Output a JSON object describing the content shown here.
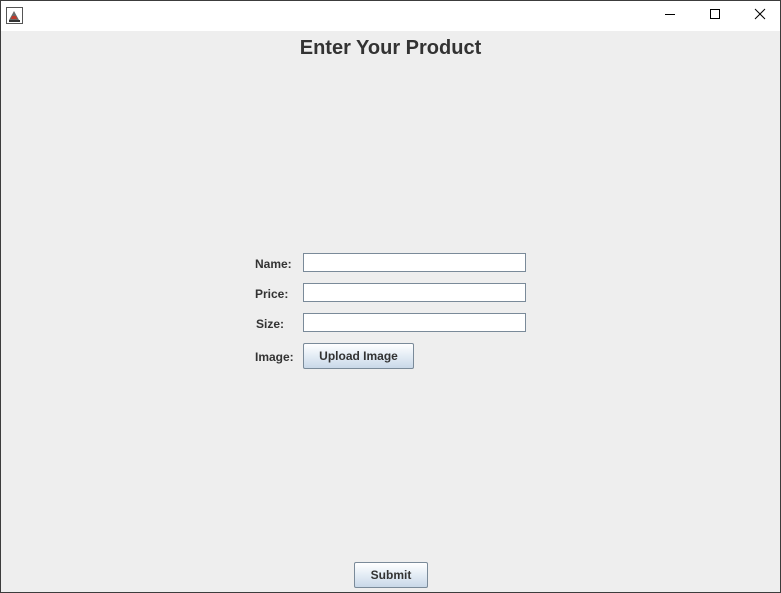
{
  "window": {
    "title": "",
    "controls": {
      "minimize": "minimize-icon",
      "maximize": "maximize-icon",
      "close": "close-icon"
    }
  },
  "form": {
    "heading": "Enter Your Product",
    "name_label": "Name:",
    "name_value": "",
    "price_label": "Price:",
    "price_value": "",
    "size_label": "Size:",
    "size_value": "",
    "image_label": "Image:",
    "upload_button": "Upload Image",
    "submit_button": "Submit"
  },
  "colors": {
    "background": "#eeeeee",
    "titlebar": "#ffffff",
    "text": "#333333",
    "field_border": "#7a8a99"
  }
}
